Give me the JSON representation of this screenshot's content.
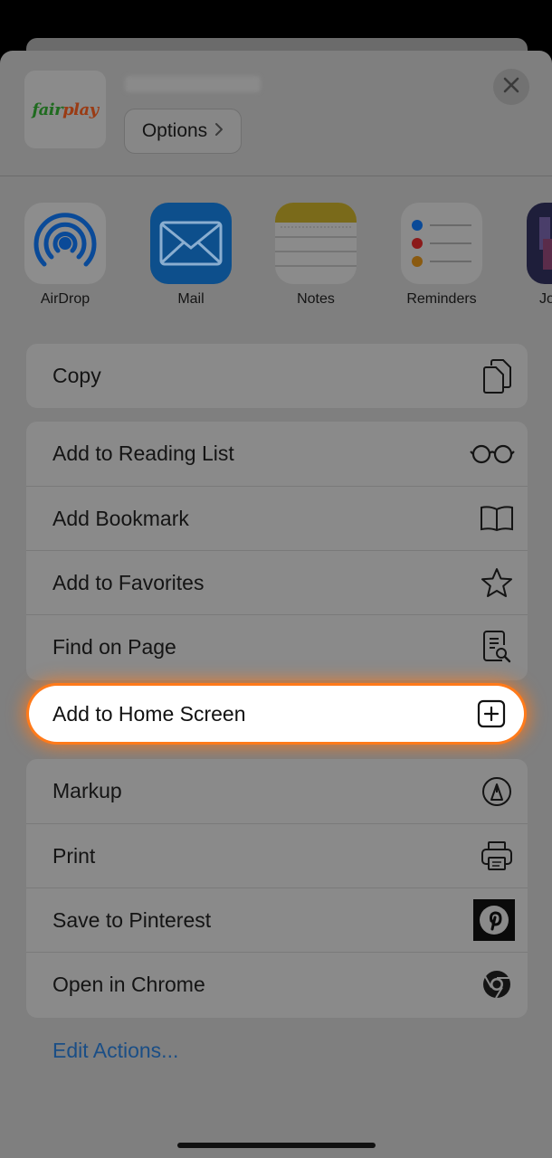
{
  "header": {
    "site_logo_text_1": "fair",
    "site_logo_text_2": "play",
    "options_label": "Options",
    "close_icon": "close-icon"
  },
  "apps": [
    {
      "label": "AirDrop",
      "icon": "airdrop-icon"
    },
    {
      "label": "Mail",
      "icon": "mail-icon"
    },
    {
      "label": "Notes",
      "icon": "notes-icon"
    },
    {
      "label": "Reminders",
      "icon": "reminders-icon"
    },
    {
      "label": "Jo",
      "icon": "app-icon"
    }
  ],
  "groups": {
    "copy": [
      {
        "label": "Copy",
        "icon": "copy-icon"
      }
    ],
    "bookmarks": [
      {
        "label": "Add to Reading List",
        "icon": "glasses-icon"
      },
      {
        "label": "Add Bookmark",
        "icon": "book-icon"
      },
      {
        "label": "Add to Favorites",
        "icon": "star-icon"
      },
      {
        "label": "Find on Page",
        "icon": "find-page-icon"
      }
    ],
    "highlight": {
      "label": "Add to Home Screen",
      "icon": "add-square-icon"
    },
    "more": [
      {
        "label": "Markup",
        "icon": "markup-icon"
      },
      {
        "label": "Print",
        "icon": "printer-icon"
      },
      {
        "label": "Save to Pinterest",
        "icon": "pinterest-icon"
      },
      {
        "label": "Open in Chrome",
        "icon": "chrome-icon"
      }
    ]
  },
  "edit_actions_label": "Edit Actions...",
  "colors": {
    "overlay": "#7f7f7f",
    "highlight_glow": "#ff7a1a",
    "link": "#1a4e86"
  }
}
